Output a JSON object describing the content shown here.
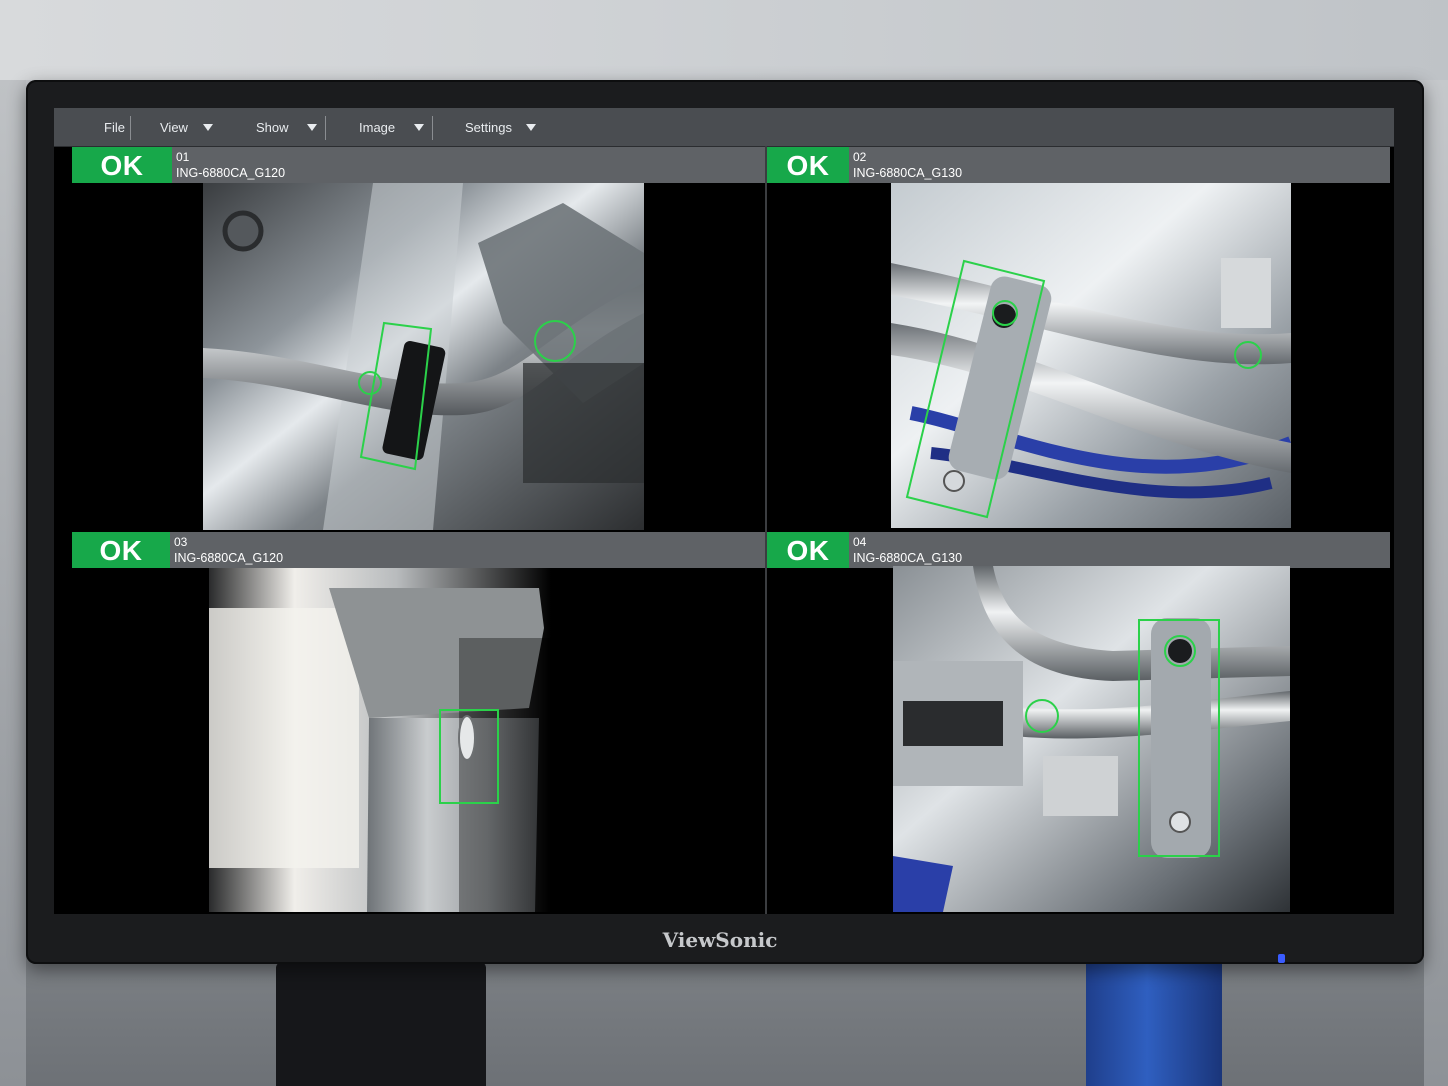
{
  "menu": {
    "items": [
      {
        "label": "File",
        "has_dropdown": false
      },
      {
        "label": "View",
        "has_dropdown": true
      },
      {
        "label": "Show",
        "has_dropdown": true
      },
      {
        "label": "Image",
        "has_dropdown": true
      },
      {
        "label": "Settings",
        "has_dropdown": true
      }
    ]
  },
  "panels": [
    {
      "status": "OK",
      "number": "01",
      "id": "ING-6880CA_G120"
    },
    {
      "status": "OK",
      "number": "02",
      "id": "ING-6880CA_G130"
    },
    {
      "status": "OK",
      "number": "03",
      "id": "ING-6880CA_G120"
    },
    {
      "status": "OK",
      "number": "04",
      "id": "ING-6880CA_G130"
    }
  ],
  "monitor": {
    "brand": "ViewSonic"
  },
  "colors": {
    "ok_green": "#17a84a",
    "detection_green": "#2bd14a",
    "menubar": "#4a4d51",
    "panel_header": "#5f6266",
    "power_led": "#3a5cff"
  },
  "icons": [
    "dropdown-caret-icon"
  ]
}
